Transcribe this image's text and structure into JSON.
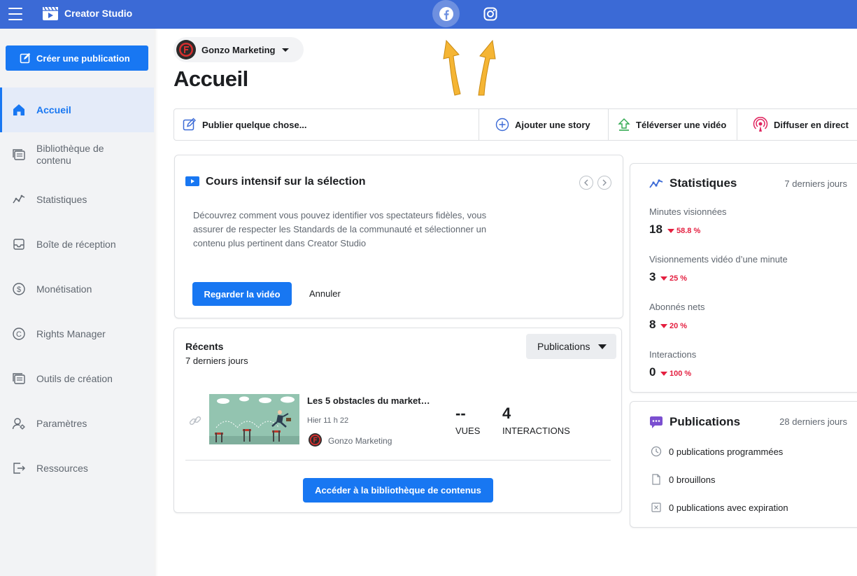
{
  "app": {
    "title": "Creator Studio",
    "brand_color": "#3b6ad6",
    "accent_color": "#1877f2"
  },
  "topbar": {
    "platforms": [
      {
        "name": "facebook-icon",
        "selected": true
      },
      {
        "name": "instagram-icon",
        "selected": false
      }
    ]
  },
  "sidebar": {
    "create_label": "Créer une publication",
    "items": [
      {
        "label": "Accueil",
        "icon": "home-icon",
        "active": true
      },
      {
        "label": "Bibliothèque de contenu",
        "icon": "library-icon",
        "active": false
      },
      {
        "label": "Statistiques",
        "icon": "insights-icon",
        "active": false
      },
      {
        "label": "Boîte de réception",
        "icon": "inbox-icon",
        "active": false
      },
      {
        "label": "Monétisation",
        "icon": "dollar-icon",
        "active": false
      },
      {
        "label": "Rights Manager",
        "icon": "copyright-icon",
        "active": false
      },
      {
        "label": "Outils de création",
        "icon": "tools-icon",
        "active": false
      },
      {
        "label": "Paramètres",
        "icon": "settings-icon",
        "active": false
      },
      {
        "label": "Ressources",
        "icon": "resources-icon",
        "active": false
      }
    ]
  },
  "account": {
    "name": "Gonzo Marketing"
  },
  "page": {
    "title": "Accueil"
  },
  "quick_actions": [
    {
      "label": "Publier quelque chose..."
    },
    {
      "label": "Ajouter une story"
    },
    {
      "label": "Téléverser une vidéo"
    },
    {
      "label": "Diffuser en direct"
    }
  ],
  "course": {
    "title": "Cours intensif sur la sélection",
    "description": "Découvrez comment vous pouvez identifier vos spectateurs fidèles, vous assurer de respecter les Standards de la communauté et sélectionner un contenu plus pertinent dans Creator Studio",
    "watch_label": "Regarder la vidéo",
    "cancel_label": "Annuler"
  },
  "recent": {
    "title": "Récents",
    "subtitle": "7 derniers jours",
    "filter_label": "Publications",
    "post": {
      "title": "Les 5 obstacles du market…",
      "date": "Hier 11 h 22",
      "page": "Gonzo Marketing",
      "views_value": "--",
      "views_label": "VUES",
      "interactions_value": "4",
      "interactions_label": "INTERACTIONS"
    },
    "library_label": "Accéder à la bibliothèque de contenus"
  },
  "stats": {
    "title": "Statistiques",
    "period": "7 derniers jours",
    "items": [
      {
        "label": "Minutes visionnées",
        "value": "18",
        "change": "58.8 %"
      },
      {
        "label": "Visionnements vidéo d’une minute",
        "value": "3",
        "change": "25 %"
      },
      {
        "label": "Abonnés nets",
        "value": "8",
        "change": "20 %"
      },
      {
        "label": "Interactions",
        "value": "0",
        "change": "100 %"
      }
    ]
  },
  "publications": {
    "title": "Publications",
    "period": "28 derniers jours",
    "items": [
      {
        "label": "0 publications programmées",
        "icon": "clock-icon"
      },
      {
        "label": "0 brouillons",
        "icon": "draft-icon"
      },
      {
        "label": "0 publications avec expiration",
        "icon": "expire-icon"
      }
    ]
  }
}
